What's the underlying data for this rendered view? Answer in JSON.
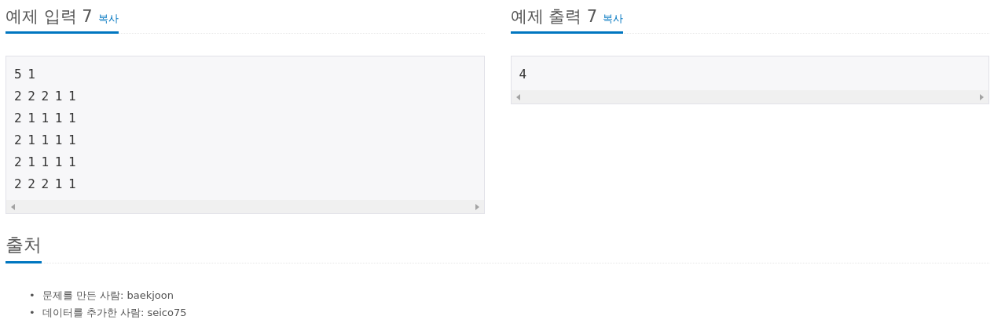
{
  "samples": [
    {
      "title": "예제 입력 7",
      "copy_link": "복사",
      "lines": [
        "5 1",
        "2 2 2 1 1",
        "2 1 1 1 1",
        "2 1 1 1 1",
        "2 1 1 1 1",
        "2 2 2 1 1"
      ]
    },
    {
      "title": "예제 출력 7",
      "copy_link": "복사",
      "lines": [
        "4"
      ]
    }
  ],
  "source": {
    "title": "출처",
    "items": [
      {
        "bullet": "•",
        "text": "문제를 만든 사람: baekjoon"
      },
      {
        "bullet": "•",
        "text": "데이터를 추가한 사람: seico75"
      }
    ]
  }
}
